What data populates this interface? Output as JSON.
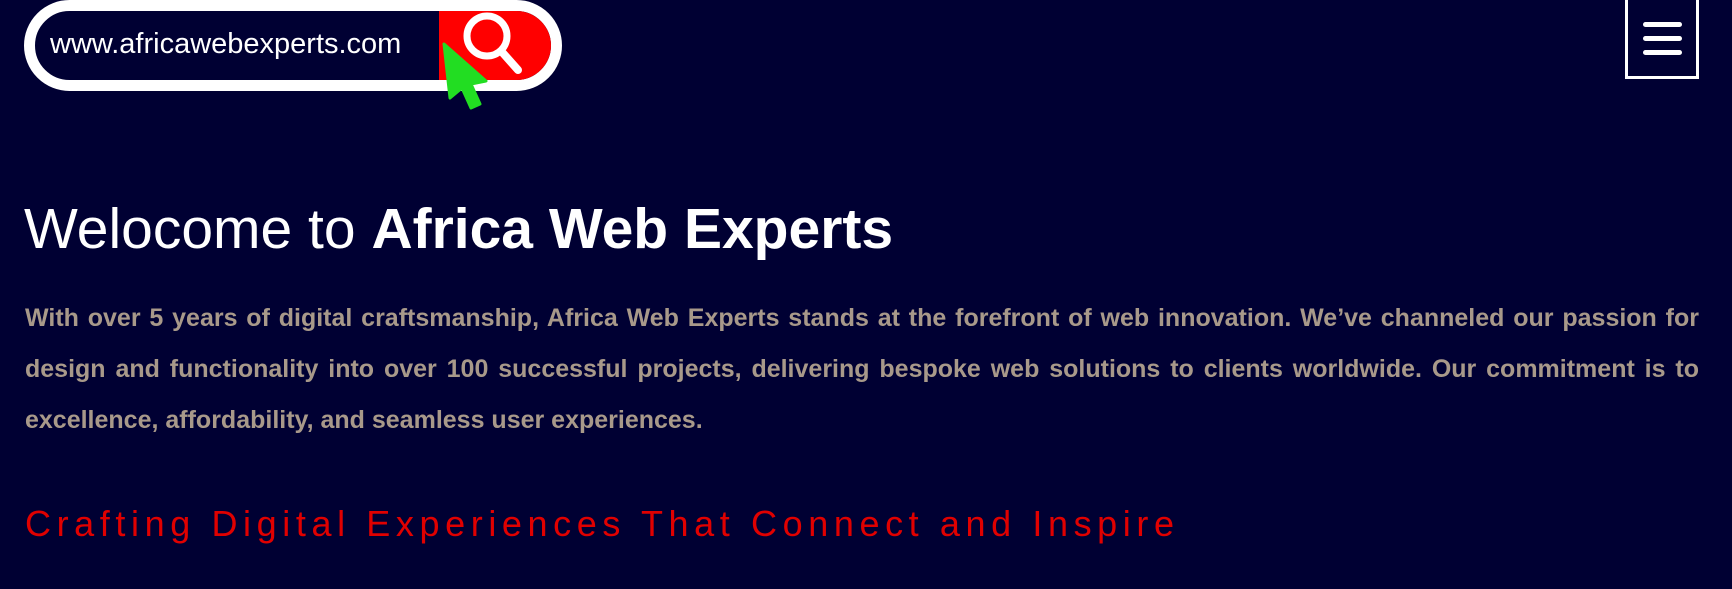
{
  "search": {
    "url_text": "www.africawebexperts.com"
  },
  "icons": {
    "search": "search-icon",
    "cursor": "cursor-icon",
    "menu": "hamburger-menu-icon"
  },
  "colors": {
    "background": "#000033",
    "search_button": "#ff0000",
    "cursor": "#22dd22",
    "body_text": "#a8998a",
    "tagline": "#e00000",
    "heading": "#ffffff"
  },
  "hero": {
    "title_prefix": "Welocome to ",
    "title_brand": "Africa Web Experts",
    "description": "With over 5 years of digital craftsmanship, Africa Web Experts stands at the forefront of web innovation. We’ve channeled our passion for design and functionality into over 100 successful projects, delivering bespoke web solutions to clients worldwide. Our commitment is to excellence, affordability, and seamless user experiences.",
    "tagline": "Crafting Digital Experiences That Connect and Inspire"
  }
}
